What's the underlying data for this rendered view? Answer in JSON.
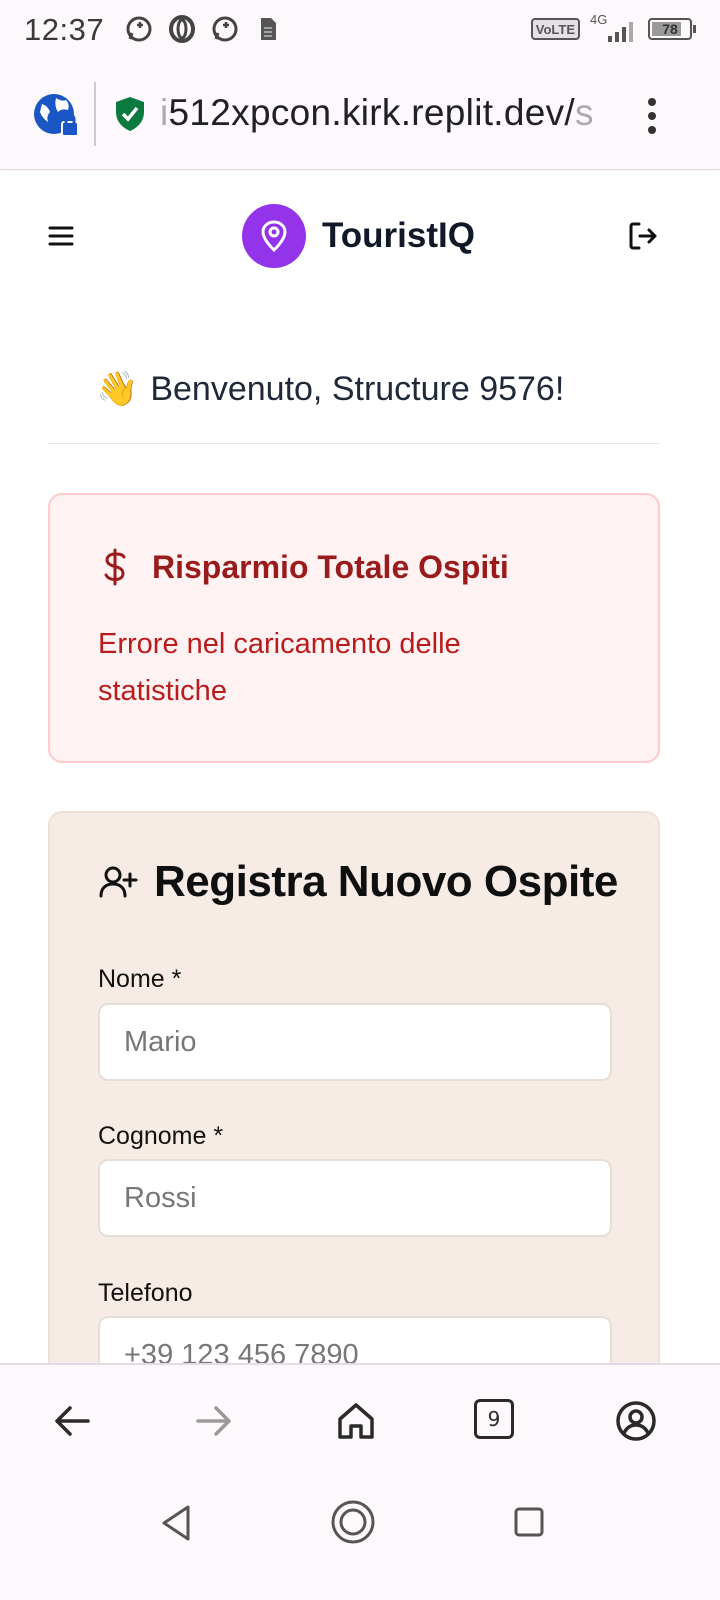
{
  "status_bar": {
    "time": "12:37",
    "volte": "VoLTE",
    "network": "4G",
    "battery": "78",
    "battery_level": 0.78
  },
  "browser": {
    "url_prefix": "i",
    "url_main": "512xpcon.kirk.replit.dev/",
    "url_suffix": "s",
    "tab_count": "9"
  },
  "header": {
    "brand_name": "TouristIQ"
  },
  "welcome": {
    "emoji": "👋",
    "text": "Benvenuto, Structure 9576!"
  },
  "stats_card": {
    "title": "Risparmio Totale Ospiti",
    "error": "Errore nel caricamento delle statistiche"
  },
  "guest_form": {
    "title": "Registra Nuovo Ospite",
    "first_name_label": "Nome *",
    "first_name_placeholder": "Mario",
    "last_name_label": "Cognome *",
    "last_name_placeholder": "Rossi",
    "phone_label": "Telefono",
    "phone_placeholder": "+39 123 456 7890"
  },
  "colors": {
    "brand_purple": "#9333ea",
    "error_text": "#b91c1c",
    "error_bg": "#fef2f2",
    "form_bg": "#f7ece5"
  }
}
